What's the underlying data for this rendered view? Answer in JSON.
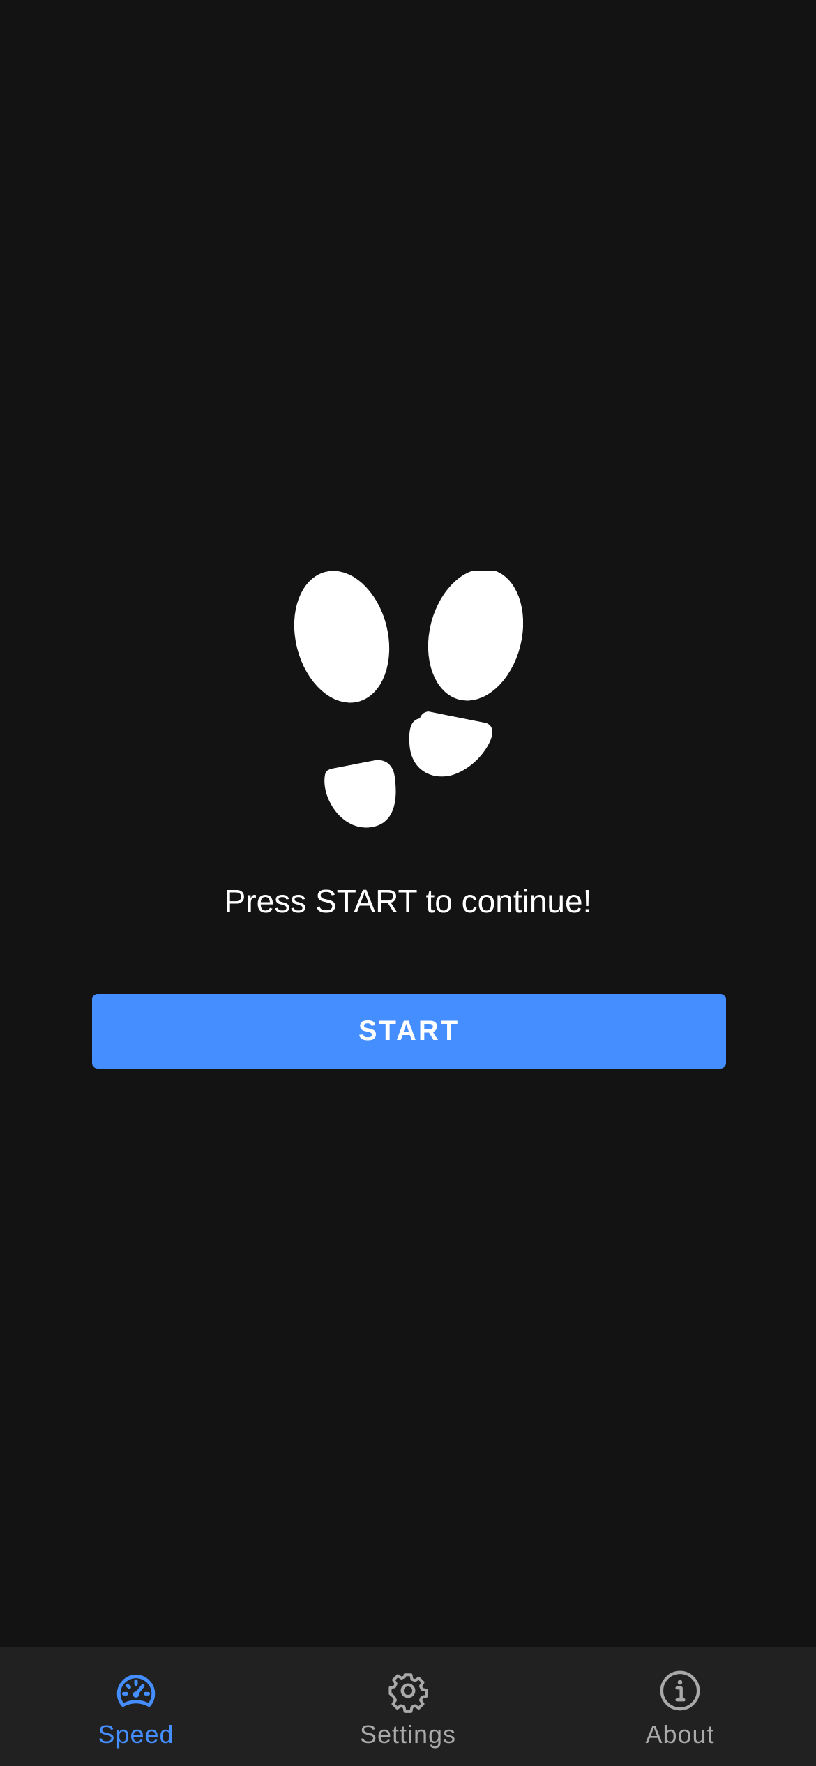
{
  "main": {
    "icon": "footprints-icon",
    "prompt": "Press START to continue!",
    "start_label": "START"
  },
  "nav": {
    "items": [
      {
        "label": "Speed",
        "icon": "speedometer-icon",
        "active": true
      },
      {
        "label": "Settings",
        "icon": "gear-icon",
        "active": false
      },
      {
        "label": "About",
        "icon": "info-icon",
        "active": false
      }
    ]
  },
  "colors": {
    "background": "#131313",
    "nav_background": "#212121",
    "accent": "#448eff",
    "inactive": "#a9a9a9",
    "text": "#ffffff"
  }
}
